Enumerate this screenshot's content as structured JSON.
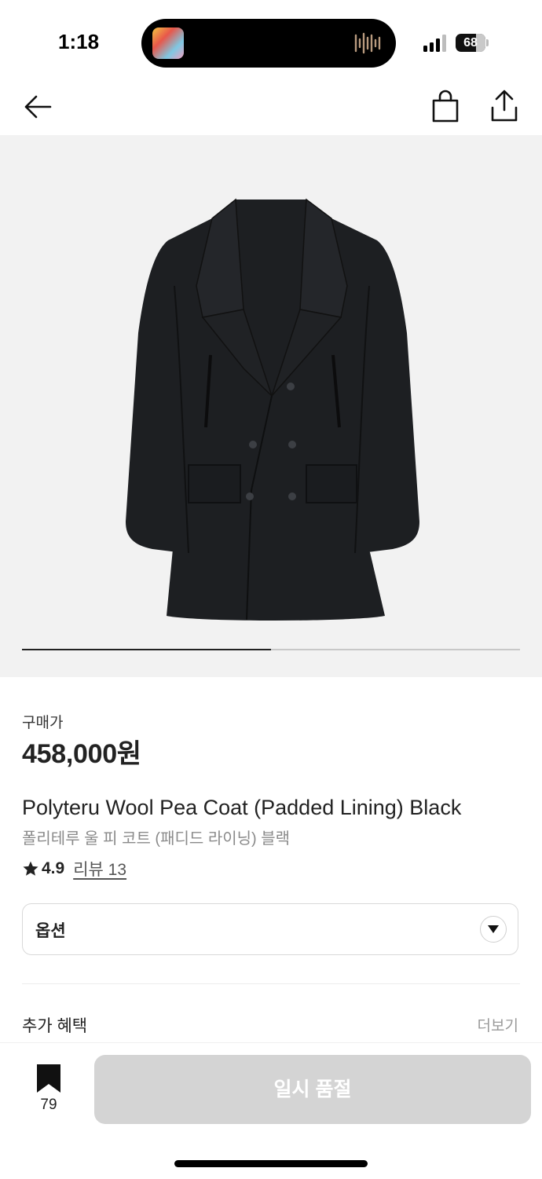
{
  "status_bar": {
    "time": "1:18",
    "battery": "68",
    "icons": [
      "now-playing-thumbnail",
      "audio-waveform-icon",
      "cellular-signal-icon",
      "battery-icon"
    ]
  },
  "nav": {
    "icons": [
      "back-arrow-icon",
      "shopping-bag-icon",
      "share-icon"
    ]
  },
  "gallery": {
    "image": "black double-breasted wool pea coat",
    "progress_fraction": 0.5
  },
  "product": {
    "price_label": "구매가",
    "price": "458,000원",
    "name_en": "Polyteru Wool Pea Coat (Padded Lining) Black",
    "name_ko": "폴리테루 울 피 코트 (패디드 라이닝) 블랙",
    "rating": "4.9",
    "review_link": "리뷰 13"
  },
  "options": {
    "label": "옵션"
  },
  "benefits": {
    "label": "추가 혜택",
    "more": "더보기"
  },
  "bottom_bar": {
    "bookmark_count": "79",
    "cta_label": "일시 품절"
  },
  "colors": {
    "text": "#222222",
    "muted": "#8a8a8a",
    "gallery_bg": "#f2f2f2",
    "cta_disabled": "#d4d4d4"
  }
}
